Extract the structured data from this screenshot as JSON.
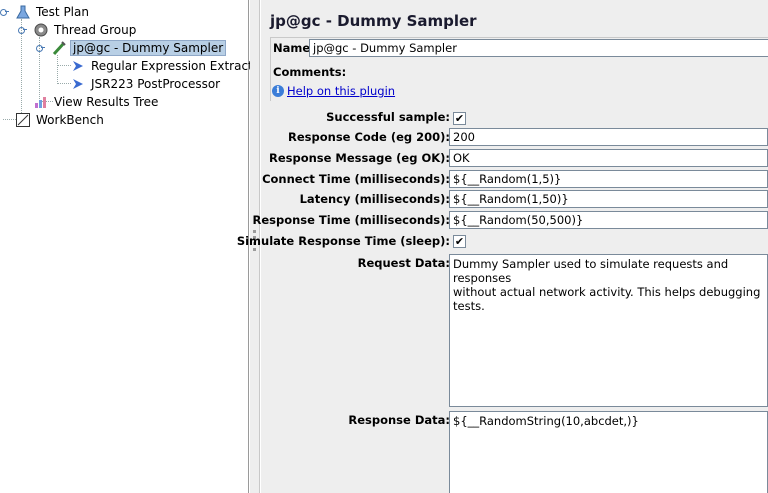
{
  "tree": {
    "test_plan": "Test Plan",
    "thread_group": "Thread Group",
    "sampler": "jp@gc - Dummy Sampler",
    "regex": "Regular Expression Extractor",
    "jsr223": "JSR223 PostProcessor",
    "view_results": "View Results Tree",
    "workbench": "WorkBench"
  },
  "panel": {
    "title": "jp@gc - Dummy Sampler",
    "name_label": "Name:",
    "name_value": "jp@gc - Dummy Sampler",
    "comments_label": "Comments:",
    "help_link": "Help on this plugin"
  },
  "form": {
    "successful_label": "Successful sample:",
    "successful_checked": "✔",
    "response_code_label": "Response Code (eg 200):",
    "response_code": "200",
    "response_message_label": "Response Message (eg OK):",
    "response_message": "OK",
    "connect_time_label": "Connect Time (milliseconds):",
    "connect_time": "${__Random(1,5)}",
    "latency_label": "Latency (milliseconds):",
    "latency": "${__Random(1,50)}",
    "response_time_label": "Response Time (milliseconds):",
    "response_time": "${__Random(50,500)}",
    "simulate_label": "Simulate Response Time (sleep):",
    "simulate_checked": "✔",
    "request_data_label": "Request Data:",
    "request_data": "Dummy Sampler used to simulate requests and responses\nwithout actual network activity. This helps debugging tests.",
    "response_data_label": "Response Data:",
    "response_data": "${__RandomString(10,abcdet,)}"
  }
}
